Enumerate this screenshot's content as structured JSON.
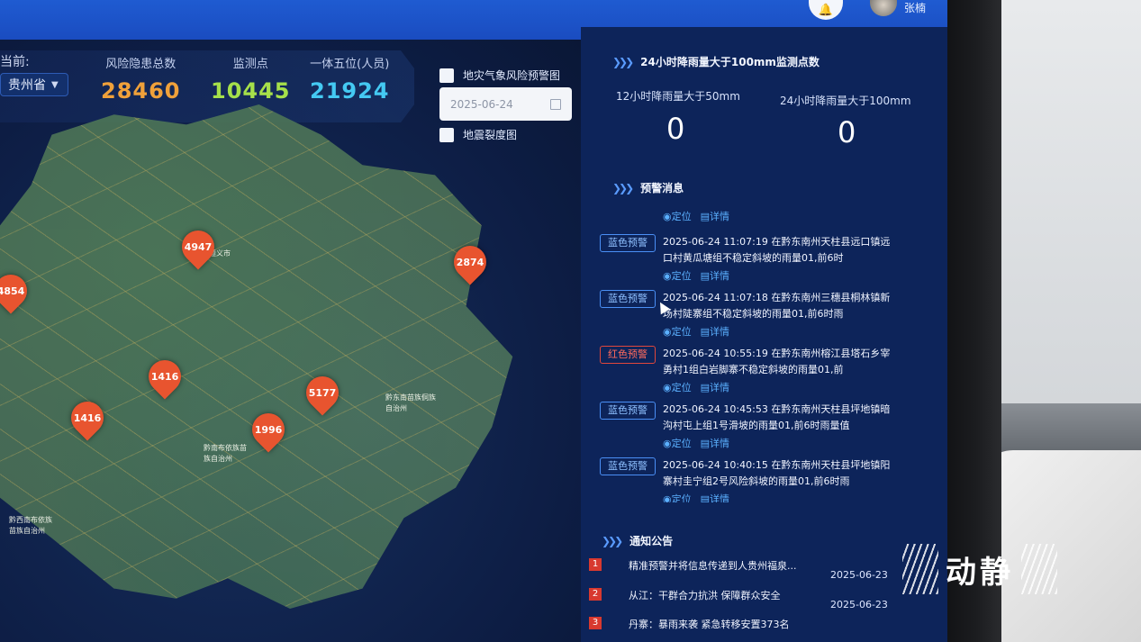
{
  "header": {
    "username": "张楠"
  },
  "stats": {
    "current_label": "当前:",
    "province": "贵州省",
    "items": [
      {
        "label": "风险隐患总数",
        "value": "28460",
        "color": "#f0a13a"
      },
      {
        "label": "监测点",
        "value": "10445",
        "color": "#a6e04a"
      },
      {
        "label": "一体五位(人员)",
        "value": "21924",
        "color": "#44c9f2"
      }
    ]
  },
  "layers": {
    "weather_warning_label": "地灾气象风险预警图",
    "date_value": "2025-06-24",
    "fracture_label": "地震裂度图"
  },
  "map": {
    "markers": [
      {
        "label": "4947",
        "city": "遵义市"
      },
      {
        "label": "2874",
        "city": ""
      },
      {
        "label": "4854",
        "city": ""
      },
      {
        "label": "1416",
        "city": ""
      },
      {
        "label": "1416",
        "city": ""
      },
      {
        "label": "5177",
        "city": ""
      },
      {
        "label": "1996",
        "city": ""
      }
    ],
    "city_labels": [
      "黔东南苗族侗族自治州",
      "黔南布依族苗族自治州",
      "黔西南布依族苗族自治州"
    ]
  },
  "rainfall": {
    "title": "24小时降雨量大于100mm监测点数",
    "items": [
      {
        "label": "12小时降雨量大于50mm",
        "value": "0"
      },
      {
        "label": "24小时降雨量大于100mm",
        "value": "0"
      }
    ]
  },
  "warnings": {
    "title": "预警消息",
    "locate_label": "定位",
    "detail_label": "详情",
    "items": [
      {
        "level": "蓝色预警",
        "color": "blue",
        "time": "2025-06-24 11:07:19",
        "text": "在黔东南州天柱县远口镇远口村黄瓜塘组不稳定斜坡的雨量01,前6时"
      },
      {
        "level": "蓝色预警",
        "color": "blue",
        "time": "2025-06-24 11:07:18",
        "text": "在黔东南州三穗县桐林镇新场村陡寨组不稳定斜坡的雨量01,前6时雨"
      },
      {
        "level": "红色预警",
        "color": "red",
        "time": "2025-06-24 10:55:19",
        "text": "在黔东南州榕江县塔石乡宰勇村1组白岩脚寨不稳定斜坡的雨量01,前"
      },
      {
        "level": "蓝色预警",
        "color": "blue",
        "time": "2025-06-24 10:45:53",
        "text": "在黔东南州天柱县坪地镇暗沟村屯上组1号滑坡的雨量01,前6时雨量值"
      },
      {
        "level": "蓝色预警",
        "color": "blue",
        "time": "2025-06-24 10:40:15",
        "text": "在黔东南州天柱县坪地镇阳寨村圭宁组2号风险斜坡的雨量01,前6时雨"
      }
    ]
  },
  "notices": {
    "title": "通知公告",
    "items": [
      {
        "num": "1",
        "title": "精准预警并将信息传递到人贵州福泉...",
        "date": "2025-06-23"
      },
      {
        "num": "2",
        "title": "从江：干群合力抗洪 保障群众安全",
        "date": "2025-06-23"
      },
      {
        "num": "3",
        "title": "丹寨：暴雨来袭 紧急转移安置373名",
        "date": ""
      }
    ]
  },
  "watermark": "动静"
}
